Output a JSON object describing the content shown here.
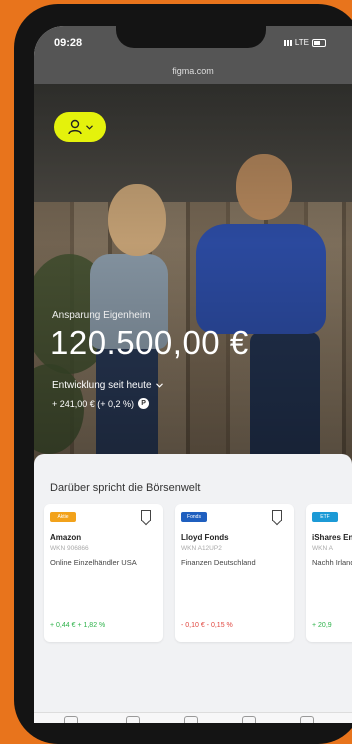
{
  "status": {
    "time": "09:28",
    "network": "LTE"
  },
  "browser": {
    "url": "figma.com"
  },
  "hero": {
    "label": "Ansparung Eigenheim",
    "amount": "120.500,00 €",
    "development_label": "Entwicklung seit heute",
    "change": "+ 241,00 € (+ 0,2 %)",
    "change_badge": "P",
    "carousel_pages": 3,
    "carousel_active": 1
  },
  "section": {
    "title": "Darüber spricht die Börsenwelt",
    "cards": [
      {
        "badge": "Aktie",
        "badge_color": "#f2a21b",
        "name": "Amazon",
        "wkn": "WKN 906866",
        "desc": "Online Einzelhändler USA",
        "perf": "+ 0,44 € + 1,82 %",
        "trend": "up"
      },
      {
        "badge": "Fonds",
        "badge_color": "#1f5fbf",
        "name": "Lloyd Fonds",
        "wkn": "WKN A12UP2",
        "desc": "Finanzen Deutschland",
        "perf": "- 0,10 € - 0,15 %",
        "trend": "down"
      },
      {
        "badge": "ETF",
        "badge_color": "#1c9ad6",
        "name": "iShares Energ",
        "wkn": "WKN A",
        "desc": "Nachh Irland",
        "perf": "+ 20,9",
        "trend": "up"
      }
    ]
  },
  "colors": {
    "accent": "#e4f20c",
    "background": "#e8741c"
  }
}
